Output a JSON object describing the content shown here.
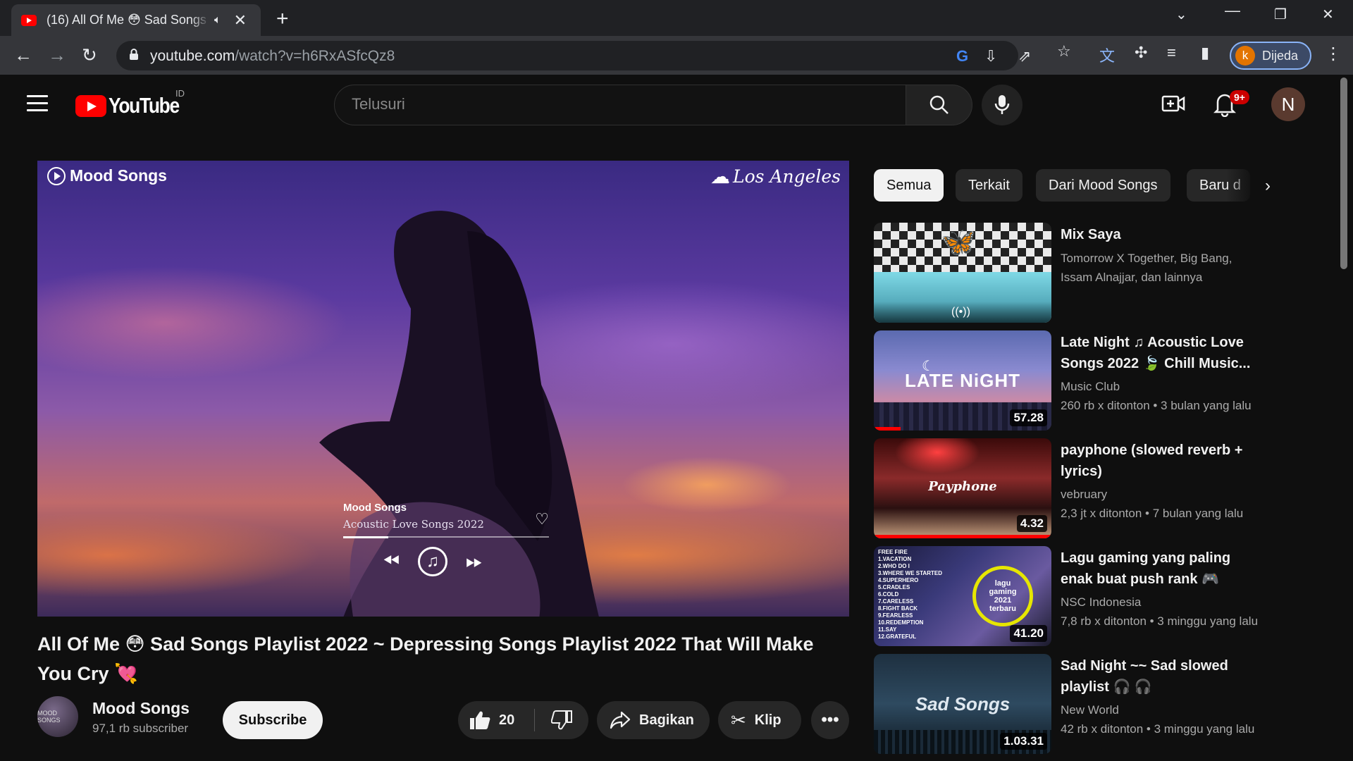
{
  "browser": {
    "tab_title": "(16) All Of Me 😳 Sad Songs",
    "url_host": "youtube.com",
    "url_path": "/watch?v=h6RxASfcQz8",
    "profile_initial": "k",
    "profile_label": "Dijeda"
  },
  "header": {
    "logo_text": "YouTube",
    "region": "ID",
    "search_placeholder": "Telusuri",
    "notification_count": "9+",
    "avatar_initial": "N"
  },
  "player": {
    "brand": "Mood Songs",
    "location": "Los Angeles",
    "card_title": "Mood Songs",
    "card_subtitle": "Acoustic Love Songs 2022",
    "card_progress": 0.22
  },
  "video": {
    "title": "All Of Me 😳 Sad Songs Playlist 2022 ~ Depressing Songs Playlist 2022 That Will Make You Cry 💘",
    "channel_name": "Mood Songs",
    "subscribers": "97,1 rb subscriber",
    "avatar_text": "MOOD SONGS",
    "subscribe_label": "Subscribe",
    "like_count": "20",
    "share_label": "Bagikan",
    "clip_label": "Klip"
  },
  "chips": [
    "Semua",
    "Terkait",
    "Dari Mood Songs",
    "Baru d"
  ],
  "recommendations": [
    {
      "title": "Mix Saya",
      "channel": "Tomorrow X Together, Big Bang, Issam Alnajjar, dan lainnya",
      "meta": ""
    },
    {
      "title": "Late Night ♫ Acoustic Love Songs 2022 🍃 Chill Music...",
      "channel": "Music Club",
      "meta": "260 rb x ditonton  • 3 bulan yang lalu",
      "duration": "57.28",
      "thumb_text": "LATE NiGHT",
      "watched": 0.15
    },
    {
      "title": "payphone (slowed reverb + lyrics)",
      "channel": "vebruary",
      "meta": "2,3 jt x ditonton  • 7 bulan yang lalu",
      "duration": "4.32",
      "thumb_text": "Payphone",
      "watched": 1.0
    },
    {
      "title": "Lagu gaming yang paling enak buat push rank 🎮",
      "channel": "NSC Indonesia",
      "meta": "7,8 rb x ditonton  • 3 minggu yang lalu",
      "duration": "41.20",
      "thumb_text": "lagu gaming 2021 terbaru",
      "thumb_list": "FREE FIRE\n1.VACATION\n2.WHO DO I\n3.WHERE WE STARTED\n4.SUPERHERO\n5.CRADLES\n6.COLD\n7.CARELESS\n8.FIGHT BACK\n9.FEARLESS\n10.REDEMPTION\n11.SAY\n12.GRATEFUL"
    },
    {
      "title": "Sad Night ~~ Sad slowed playlist 🎧 🎧",
      "channel": "New World",
      "meta": "42 rb x ditonton  • 3 minggu yang lalu",
      "duration": "1.03.31",
      "thumb_text": "Sad Songs"
    }
  ],
  "colors": {
    "accent": "#ff0000",
    "background": "#0f0f0f",
    "chip": "#272727"
  }
}
